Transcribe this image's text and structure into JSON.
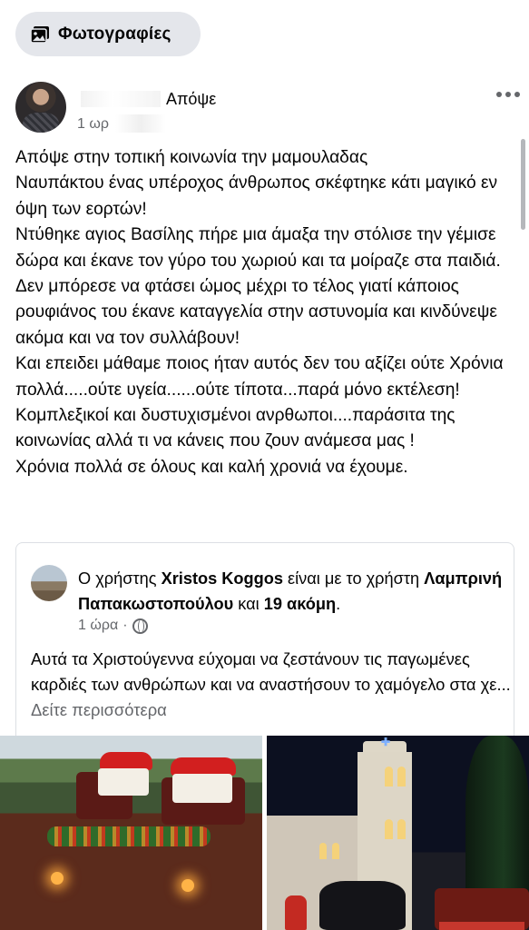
{
  "chip": {
    "label": "Φωτογραφίες",
    "icon": "photos-icon"
  },
  "post": {
    "author_suffix": "Απόψε",
    "meta": "1 ωρ",
    "body": "Απόψε στην τοπική κοινωνία την μαμουλαδας\nΝαυπάκτου ένας υπέροχος άνθρωπος σκέφτηκε κάτι μαγικό εν όψη των εορτών!\nΝτύθηκε αγιος Βασίλης πήρε μια άμαξα την στόλισε την γέμισε δώρα και έκανε τον γύρο του χωριού και τα μοίραζε στα παιδιά.\nΔεν μπόρεσε να φτάσει ώμος μέχρι το τέλος γιατί κάποιος ρουφιάνος του έκανε καταγγελία στην αστυνομία και κινδύνεψε ακόμα και να τον συλλάβουν!\nΚαι επειδει μάθαμε ποιος ήταν αυτός δεν του αξίζει ούτε Χρόνια πολλά.....ούτε υγεία......ούτε τίποτα...παρά μόνο εκτέλεση!\nΚομπλεξικοί και δυστυχισμένοι ανρθωποι....παράσιτα της κοινωνίας αλλά τι να κάνεις που ζουν ανάμεσα μας !\nΧρόνια πολλά σε όλους και καλή χρονιά να έχουμε."
  },
  "shared": {
    "prefix": "Ο χρήστης ",
    "user": "Xristos Koggos",
    "mid": " είναι με το χρήστη ",
    "tagged": "Λαμπρινή Παπακωστοπούλου",
    "and": " και ",
    "others": "19 ακόμη",
    "end": ".",
    "time": "1 ώρα",
    "dot": "·",
    "text": "Αυτά τα Χριστούγεννα εύχομαι να ζεστάνουν τις παγωμένες καρδιές των ανθρώπων και να αναστήσουν το χαμόγελο στα χε...",
    "see_more": "Δείτε περισσότερα"
  },
  "colors": {
    "chip_bg": "#e4e6eb",
    "meta": "#65676b",
    "text": "#050505"
  }
}
